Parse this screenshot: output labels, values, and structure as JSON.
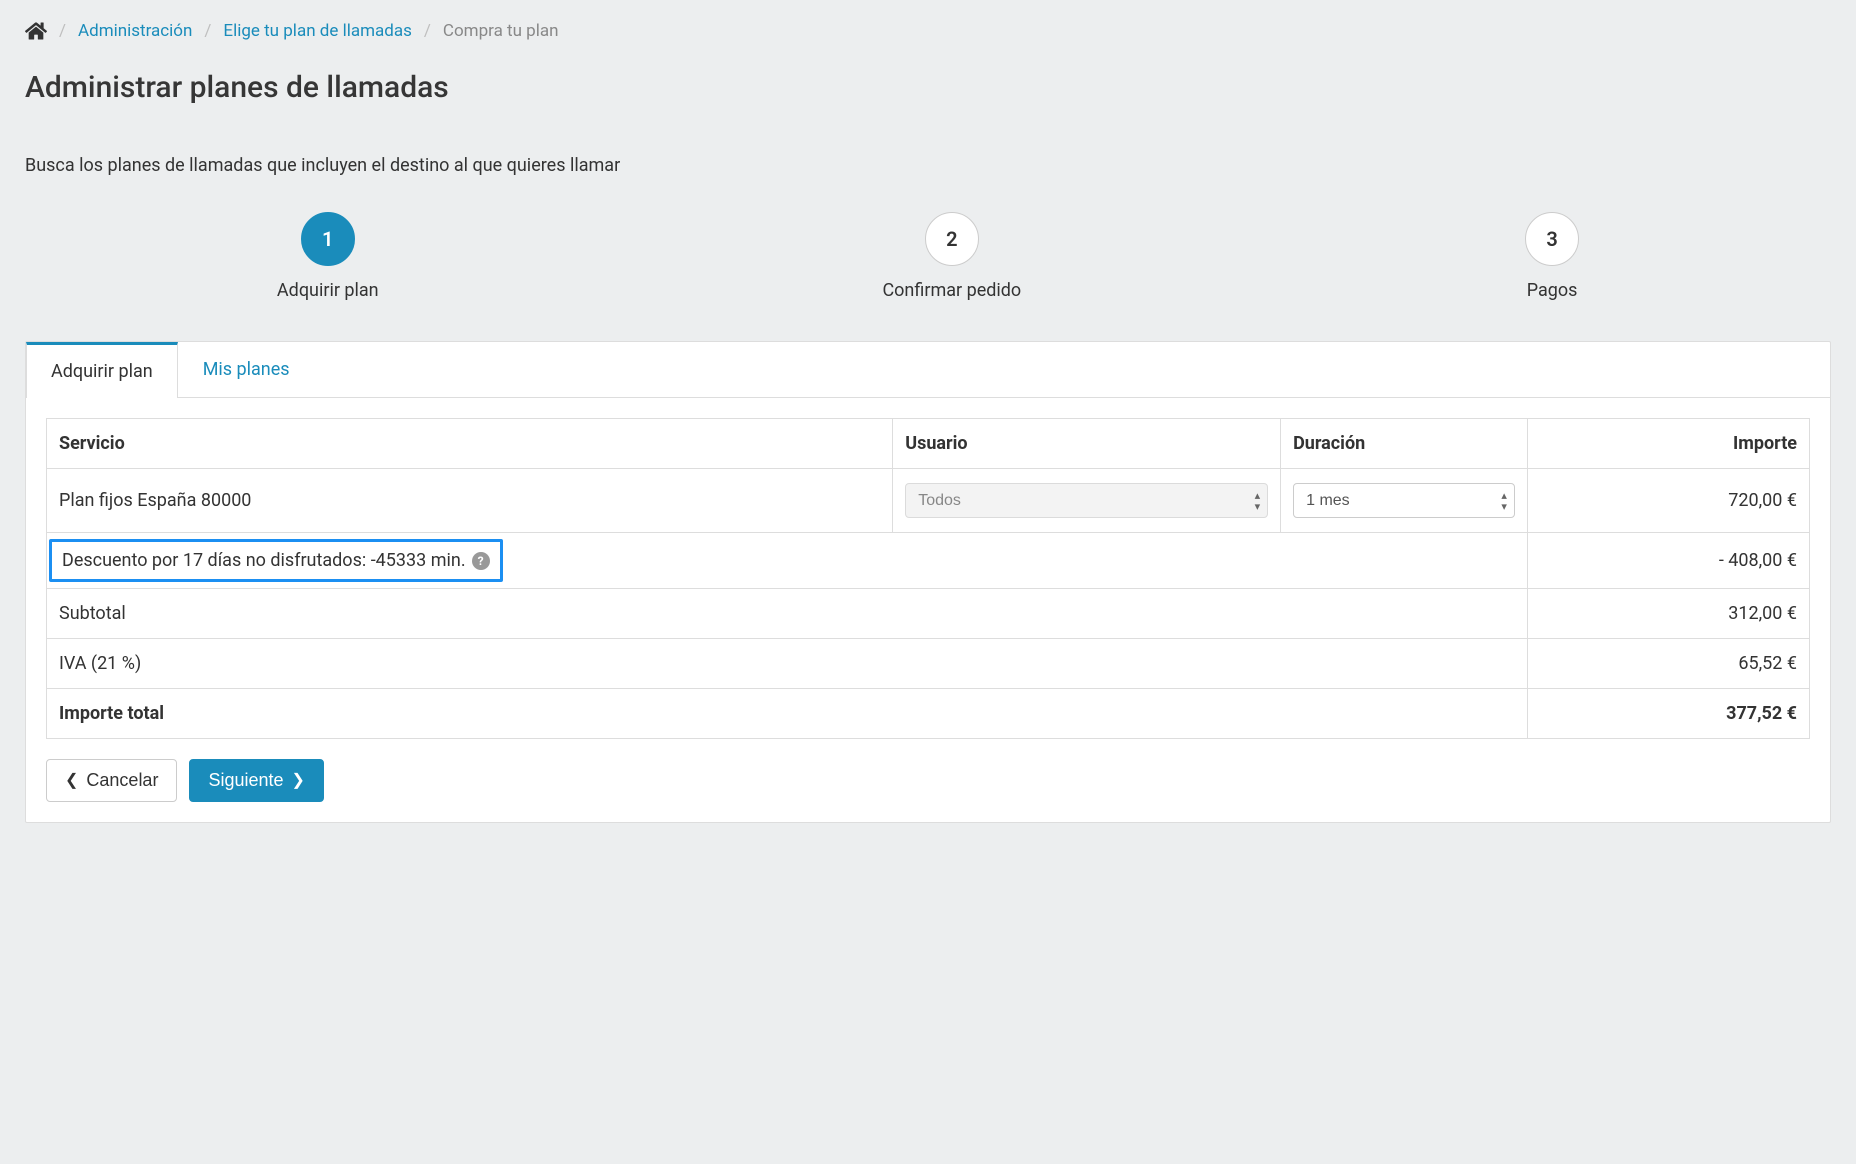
{
  "breadcrumb": {
    "items": [
      {
        "label": "Administración"
      },
      {
        "label": "Elige tu plan de llamadas"
      }
    ],
    "current": "Compra tu plan"
  },
  "page": {
    "title": "Administrar planes de llamadas",
    "subtitle": "Busca los planes de llamadas que incluyen el destino al que quieres llamar"
  },
  "wizard": {
    "steps": [
      {
        "num": "1",
        "label": "Adquirir plan",
        "active": true
      },
      {
        "num": "2",
        "label": "Confirmar pedido",
        "active": false
      },
      {
        "num": "3",
        "label": "Pagos",
        "active": false
      }
    ]
  },
  "tabs": {
    "active": "Adquirir plan",
    "other": "Mis planes"
  },
  "table": {
    "headers": {
      "servicio": "Servicio",
      "usuario": "Usuario",
      "duracion": "Duración",
      "importe": "Importe"
    },
    "plan": {
      "servicio": "Plan fijos España 80000",
      "usuario_selected": "Todos",
      "duracion_selected": "1 mes",
      "importe": "720,00 €"
    },
    "descuento": {
      "label": "Descuento por 17 días no disfrutados: -45333 min.",
      "importe": "- 408,00 €"
    },
    "subtotal": {
      "label": "Subtotal",
      "importe": "312,00 €"
    },
    "iva": {
      "label": "IVA (21 %)",
      "importe": "65,52 €"
    },
    "total": {
      "label": "Importe total",
      "importe": "377,52 €"
    }
  },
  "actions": {
    "cancel": "Cancelar",
    "next": "Siguiente"
  }
}
